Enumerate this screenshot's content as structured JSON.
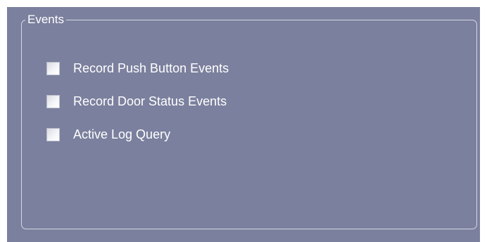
{
  "group": {
    "title": "Events"
  },
  "options": [
    {
      "label": "Record Push Button Events",
      "checked": false
    },
    {
      "label": "Record Door Status Events",
      "checked": false
    },
    {
      "label": "Active Log Query",
      "checked": false
    }
  ],
  "colors": {
    "panel_background": "#7b809e",
    "group_border": "#d6d8e2",
    "text": "#ffffff"
  }
}
